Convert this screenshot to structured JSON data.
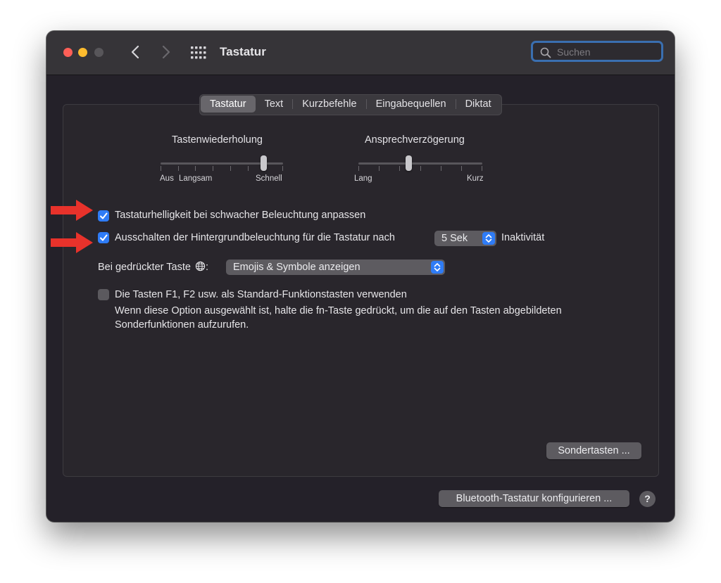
{
  "window": {
    "title": "Tastatur",
    "search_placeholder": "Suchen"
  },
  "tabs": [
    {
      "label": "Tastatur",
      "active": true
    },
    {
      "label": "Text",
      "active": false
    },
    {
      "label": "Kurzbefehle",
      "active": false
    },
    {
      "label": "Eingabequellen",
      "active": false
    },
    {
      "label": "Diktat",
      "active": false
    }
  ],
  "key_repeat": {
    "label": "Tastenwiederholung",
    "tick_labels": [
      "Aus",
      "Langsam",
      "Schnell"
    ],
    "level_fraction": 0.86
  },
  "delay_until_repeat": {
    "label": "Ansprechverzögerung",
    "tick_labels": [
      "Lang",
      "Kurz"
    ],
    "level_fraction": 0.4
  },
  "options": {
    "adjust_brightness": {
      "label": "Tastaturhelligkeit bei schwacher Beleuchtung anpassen",
      "checked": true
    },
    "backlight_off": {
      "label": "Ausschalten der Hintergrundbeleuchtung für die Tastatur nach",
      "checked": true,
      "value": "5 Sek",
      "suffix": "Inaktivität"
    },
    "globe_key": {
      "label": "Bei gedrückter Taste",
      "colon": ":",
      "value": "Emojis & Symbole anzeigen"
    },
    "function_keys": {
      "label": "Die Tasten F1, F2 usw. als Standard-Funktionstasten verwenden",
      "checked": false,
      "description_line1": "Wenn diese Option ausgewählt ist, halte die fn-Taste gedrückt, um die auf den Tasten abgebildeten",
      "description_line2": "Sonderfunktionen aufzurufen."
    }
  },
  "buttons": {
    "modifier_keys": "Sondertasten ...",
    "bluetooth": "Bluetooth-Tastatur konfigurieren ...",
    "help": "?"
  },
  "colors": {
    "accent": "#2f7cf6",
    "annotation_arrow": "#e8322b"
  }
}
